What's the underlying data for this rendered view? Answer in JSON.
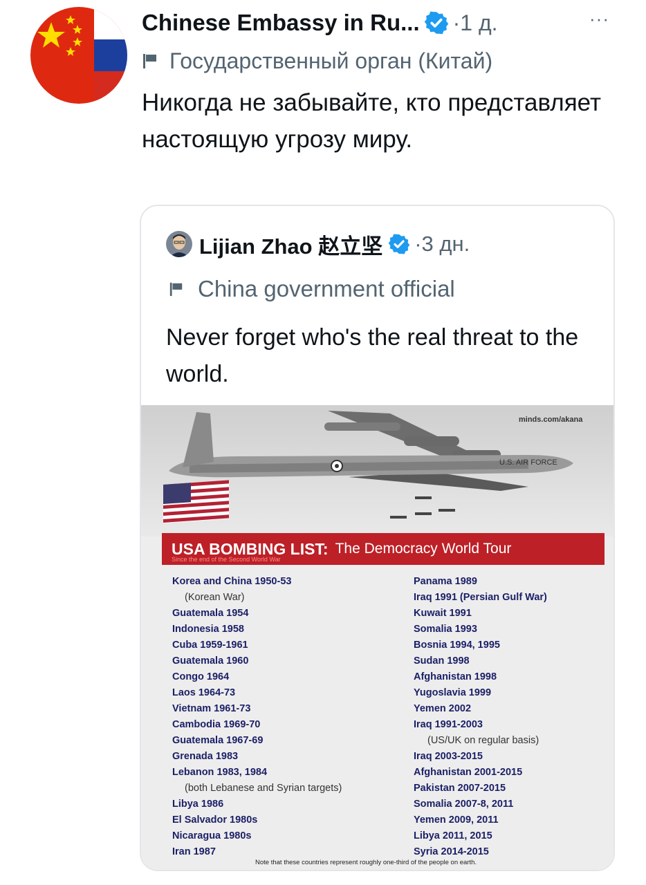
{
  "tweet": {
    "author_name": "Chinese Embassy in Ru...",
    "verified_icon": "verified-badge-icon",
    "timestamp": "·1 д.",
    "more_label": "···",
    "label_icon": "flag-icon",
    "label_text": "Государственный орган (Китай)",
    "text": "Никогда не забывайте, кто представляет настоящую угрозу миру.",
    "avatar_icon": "china-russia-flag-avatar"
  },
  "quoted": {
    "author_name": "Lijian Zhao 赵立坚",
    "verified_icon": "verified-badge-icon",
    "timestamp": "·3 дн.",
    "label_icon": "flag-icon",
    "label_text": "China government official",
    "text": "Never forget who's the real threat to the world.",
    "image": {
      "watermark": "minds.com/akana",
      "plane_marking": "U.S. AIR FORCE",
      "title_strong": "USA BOMBING LIST:",
      "title_light": "The Democracy World Tour",
      "subtitle": "Since the end of the Second World War",
      "left_list": [
        "Korea and China 1950-53",
        "(Korean War)",
        "Guatemala 1954",
        "Indonesia 1958",
        "Cuba 1959-1961",
        "Guatemala 1960",
        "Congo 1964",
        "Laos 1964-73",
        "Vietnam 1961-73",
        "Cambodia 1969-70",
        "Guatemala 1967-69",
        "Grenada 1983",
        "Lebanon 1983, 1984",
        "(both Lebanese and Syrian targets)",
        "Libya 1986",
        "El Salvador 1980s",
        "Nicaragua 1980s",
        "Iran 1987"
      ],
      "right_list": [
        "Panama 1989",
        "Iraq 1991 (Persian Gulf War)",
        "Kuwait 1991",
        "Somalia 1993",
        "Bosnia 1994, 1995",
        "Sudan 1998",
        "Afghanistan 1998",
        "Yugoslavia 1999",
        "Yemen 2002",
        "Iraq 1991-2003",
        "(US/UK on regular basis)",
        "Iraq 2003-2015",
        "Afghanistan 2001-2015",
        "Pakistan 2007-2015",
        "Somalia 2007-8, 2011",
        "Yemen 2009, 2011",
        "Libya 2011, 2015",
        "Syria 2014-2015"
      ],
      "footnote": "Note that these countries represent roughly one-third of the people on earth."
    }
  },
  "colors": {
    "text_primary": "#0f1419",
    "text_secondary": "#536471",
    "verified": "#1d9bf0",
    "banner_red": "#bd2027",
    "list_navy": "#1b1f66"
  }
}
